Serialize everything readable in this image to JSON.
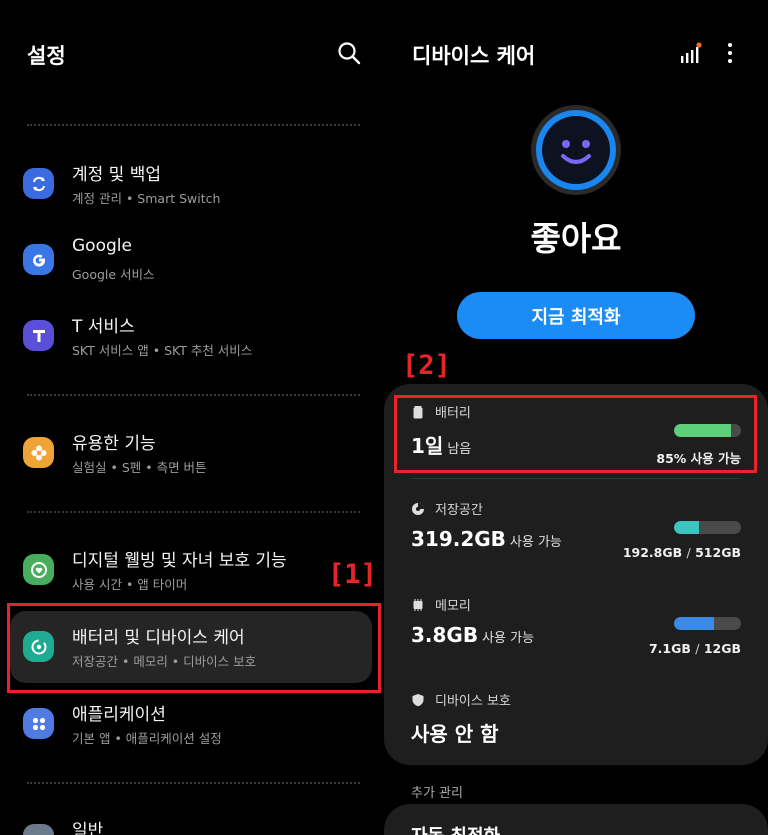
{
  "left": {
    "title": "설정",
    "items": [
      {
        "title": "계정 및 백업",
        "subtitle": "계정 관리 • Smart Switch",
        "icon": "sync-icon",
        "color": "#3c6be0"
      },
      {
        "title": "Google",
        "subtitle": "Google 서비스",
        "icon": "google-icon",
        "color": "#3a76e6"
      },
      {
        "title": "T 서비스",
        "subtitle": "SKT 서비스 앱 • SKT 추천 서비스",
        "icon": "t-icon",
        "color": "#5a4fd8"
      },
      {
        "title": "유용한 기능",
        "subtitle": "실험실 • S펜 • 측면 버튼",
        "icon": "flower-icon",
        "color": "#f0a336"
      },
      {
        "title": "디지털 웰빙 및 자녀 보호 기능",
        "subtitle": "사용 시간 • 앱 타이머",
        "icon": "heart-circle-icon",
        "color": "#49ad5f"
      },
      {
        "title": "배터리 및 디바이스 케어",
        "subtitle": "저장공간 • 메모리 • 디바이스 보호",
        "icon": "device-care-icon",
        "color": "#1faa92"
      },
      {
        "title": "애플리케이션",
        "subtitle": "기본 앱 • 애플리케이션 설정",
        "icon": "apps-grid-icon",
        "color": "#4f7be3"
      },
      {
        "title": "일반",
        "subtitle": "",
        "icon": "general-icon",
        "color": "#6b7a8c"
      }
    ],
    "annotation_1": "[1]"
  },
  "right": {
    "title": "디바이스 케어",
    "status": "좋아요",
    "optimize_button": "지금 최적화",
    "annotation_2": "[2]",
    "battery": {
      "label": "배터리",
      "value": "1일",
      "unit": "남음",
      "level": 0.85,
      "right_text": "85% 사용 가능",
      "bar_color": "#5fd07a"
    },
    "storage": {
      "label": "저장공간",
      "value": "319.2GB",
      "unit": "사용 가능",
      "level": 0.37,
      "used": "192.8GB",
      "sep": "/",
      "total": "512GB",
      "bar_color": "#3cc4c0"
    },
    "memory": {
      "label": "메모리",
      "value": "3.8GB",
      "unit": "사용 가능",
      "level": 0.6,
      "used": "7.1GB",
      "sep": "/",
      "total": "12GB",
      "bar_color": "#3a8ae6"
    },
    "protection": {
      "label": "디바이스 보호",
      "value": "사용 안 함"
    },
    "extra_label": "추가 관리",
    "auto_optimize": "자동 최적화"
  }
}
